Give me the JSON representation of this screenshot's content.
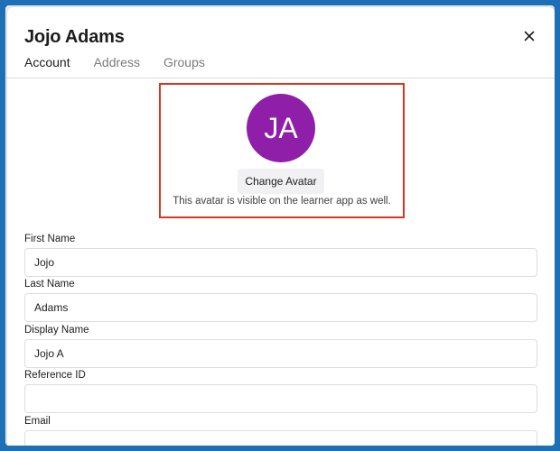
{
  "modal": {
    "title": "Jojo Adams",
    "tabs": [
      {
        "label": "Account",
        "active": true
      },
      {
        "label": "Address",
        "active": false
      },
      {
        "label": "Groups",
        "active": false
      }
    ]
  },
  "avatar": {
    "initials": "JA",
    "color": "#8f1fa8",
    "change_label": "Change Avatar",
    "note": "This avatar is visible on the learner app as well."
  },
  "fields": {
    "first_name": {
      "label": "First Name",
      "value": "Jojo"
    },
    "last_name": {
      "label": "Last Name",
      "value": "Adams"
    },
    "display_name": {
      "label": "Display Name",
      "value": "Jojo A"
    },
    "reference_id": {
      "label": "Reference ID",
      "value": ""
    },
    "email": {
      "label": "Email",
      "value": ""
    }
  },
  "colors": {
    "highlight_border": "#d9361e",
    "frame": "#1e6fb5"
  }
}
